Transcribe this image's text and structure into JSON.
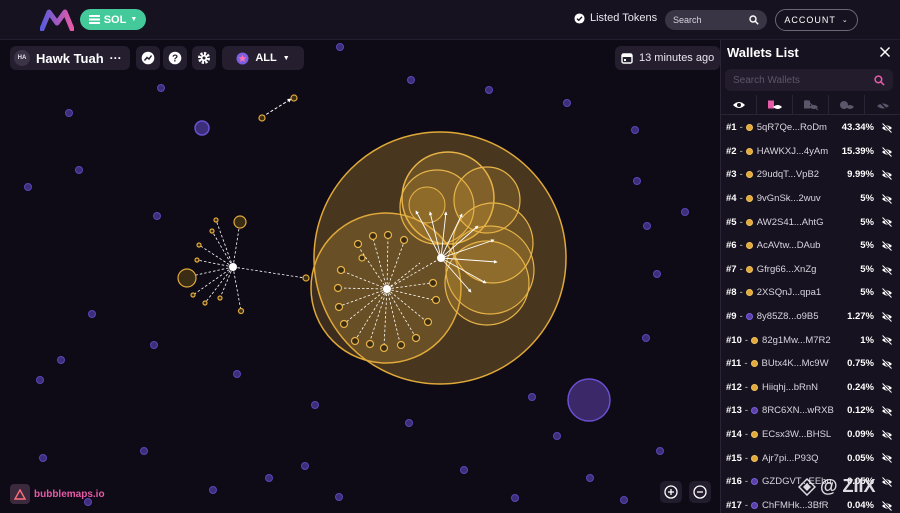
{
  "topbar": {
    "chain": "SOL",
    "listed_tokens": "Listed Tokens",
    "search_placeholder": "Search",
    "account": "ACCOUNT"
  },
  "toolbar": {
    "token_avatar": "HA",
    "token_name": "Hawk Tuah",
    "more": "···",
    "filter": "ALL",
    "last_update": "13 minutes ago"
  },
  "brand": "bubblemaps.io",
  "colors": {
    "accent": "#e0a93a",
    "violet": "#5a3fa6",
    "chain_green": "#44c99b",
    "pink": "#e65aa8"
  },
  "sidebar": {
    "title": "Wallets List",
    "search_placeholder": "Search Wallets",
    "rows": [
      {
        "rank": "#1",
        "addr": "5qR7Qe...RoDm",
        "pct": "43.34%",
        "color": "#e0a93a"
      },
      {
        "rank": "#2",
        "addr": "HAWKXJ...4yAm",
        "pct": "15.39%",
        "color": "#e0a93a"
      },
      {
        "rank": "#3",
        "addr": "29udqT...VpB2",
        "pct": "9.99%",
        "color": "#e0a93a"
      },
      {
        "rank": "#4",
        "addr": "9vGnSk...2wuv",
        "pct": "5%",
        "color": "#e0a93a"
      },
      {
        "rank": "#5",
        "addr": "AW2S41...AhtG",
        "pct": "5%",
        "color": "#e0a93a"
      },
      {
        "rank": "#6",
        "addr": "AcAVtw...DAub",
        "pct": "5%",
        "color": "#e0a93a"
      },
      {
        "rank": "#7",
        "addr": "Gfrg66...XnZg",
        "pct": "5%",
        "color": "#e0a93a"
      },
      {
        "rank": "#8",
        "addr": "2XSQnJ...qpa1",
        "pct": "5%",
        "color": "#e0a93a"
      },
      {
        "rank": "#9",
        "addr": "8y85Z8...o9B5",
        "pct": "1.27%",
        "color": "#5a3fa6"
      },
      {
        "rank": "#10",
        "addr": "82g1Mw...M7R2",
        "pct": "1%",
        "color": "#e0a93a"
      },
      {
        "rank": "#11",
        "addr": "BUtx4K...Mc9W",
        "pct": "0.75%",
        "color": "#e0a93a"
      },
      {
        "rank": "#12",
        "addr": "Hiiqhj...bRnN",
        "pct": "0.24%",
        "color": "#e0a93a"
      },
      {
        "rank": "#13",
        "addr": "8RC6XN...wRXB",
        "pct": "0.12%",
        "color": "#5a3fa6"
      },
      {
        "rank": "#14",
        "addr": "ECsx3W...BHSL",
        "pct": "0.09%",
        "color": "#e0a93a"
      },
      {
        "rank": "#15",
        "addr": "Ajr7pi...P93Q",
        "pct": "0.05%",
        "color": "#e0a93a"
      },
      {
        "rank": "#16",
        "addr": "GZDGVT...EEbu",
        "pct": "0.05%",
        "color": "#5a3fa6"
      },
      {
        "rank": "#17",
        "addr": "ChFMHk...3BfR",
        "pct": "0.04%",
        "color": "#5a3fa6"
      }
    ]
  },
  "watermark": "@ ZIIX"
}
